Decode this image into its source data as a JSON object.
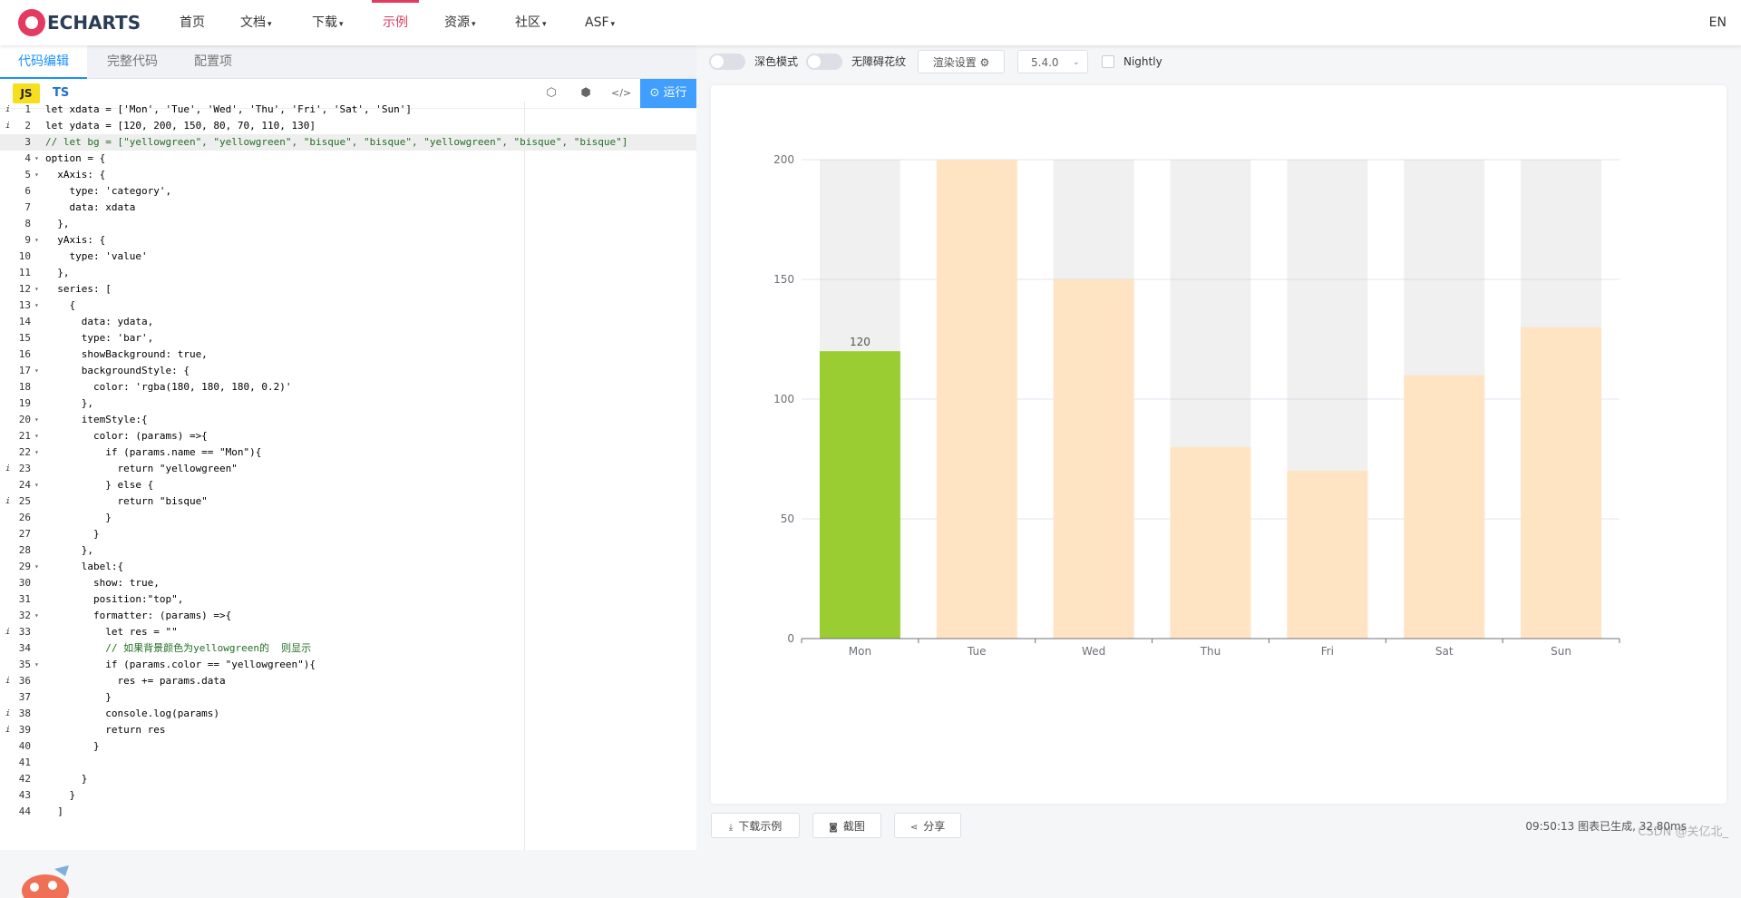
{
  "nav": {
    "logo": "ECHARTS",
    "items": [
      {
        "label": "首页",
        "caret": ""
      },
      {
        "label": "文档",
        "caret": "▾"
      },
      {
        "label": "下载",
        "caret": "▾"
      },
      {
        "label": "示例",
        "caret": ""
      },
      {
        "label": "资源",
        "caret": "▾"
      },
      {
        "label": "社区",
        "caret": "▾"
      },
      {
        "label": "ASF",
        "caret": "▾"
      }
    ],
    "active_item": "示例",
    "lang": "EN"
  },
  "editor": {
    "tabs": [
      "代码编辑",
      "完整代码",
      "配置项"
    ],
    "active_tab": "代码编辑",
    "lang_js": "JS",
    "lang_ts": "TS",
    "run_label": "运行",
    "run_icon": "⊙",
    "tool_icons": [
      "codepen-icon",
      "codesandbox-icon",
      "code-icon"
    ],
    "tool_glyphs": [
      "⬡",
      "⬢",
      "</>"
    ],
    "highlight_line": 3,
    "info_lines": [
      1,
      2,
      23,
      25,
      33,
      36,
      38,
      39
    ],
    "fold_lines": [
      4,
      5,
      9,
      12,
      13,
      17,
      20,
      21,
      22,
      24,
      29,
      32,
      35
    ],
    "lines": [
      "let xdata = ['Mon', 'Tue', 'Wed', 'Thu', 'Fri', 'Sat', 'Sun']",
      "let ydata = [120, 200, 150, 80, 70, 110, 130]",
      "// let bg = [\"yellowgreen\", \"yellowgreen\", \"bisque\", \"bisque\", \"yellowgreen\", \"bisque\", \"bisque\"]",
      "option = {",
      "  xAxis: {",
      "    type: 'category',",
      "    data: xdata",
      "  },",
      "  yAxis: {",
      "    type: 'value'",
      "  },",
      "  series: [",
      "    {",
      "      data: ydata,",
      "      type: 'bar',",
      "      showBackground: true,",
      "      backgroundStyle: {",
      "        color: 'rgba(180, 180, 180, 0.2)'",
      "      },",
      "      itemStyle:{",
      "        color: (params) =>{",
      "          if (params.name == \"Mon\"){",
      "            return \"yellowgreen\"",
      "          } else {",
      "            return \"bisque\"",
      "          }",
      "        }",
      "      },",
      "      label:{",
      "        show: true,",
      "        position:\"top\",",
      "        formatter: (params) =>{",
      "          let res = \"\"",
      "          // 如果背景颜色为yellowgreen的  则显示",
      "          if (params.color == \"yellowgreen\"){",
      "            res += params.data",
      "          }",
      "          console.log(params)",
      "          return res",
      "        }",
      "",
      "      }",
      "    }",
      "  ]"
    ]
  },
  "preview": {
    "dark_mode_label": "深色模式",
    "accessible_label": "无障碍花纹",
    "render_label": "渲染设置",
    "render_icon": "⚙",
    "version": "5.4.0",
    "version_caret": "⌄",
    "nightly_label": "Nightly",
    "download_label": "下载示例",
    "download_icon": "⤓",
    "screenshot_label": "截图",
    "screenshot_icon": "◙",
    "share_label": "分享",
    "share_icon": "⋖",
    "status": "09:50:13  图表已生成, 32.80ms",
    "watermark": "CSDN @关亿北_"
  },
  "colors": {
    "highlight": "#9acd32",
    "bar": "#ffe4c4",
    "background_bar": "rgba(180,180,180,0.2)",
    "accent": "#e43961",
    "run": "#409eff"
  },
  "chart_data": {
    "type": "bar",
    "categories": [
      "Mon",
      "Tue",
      "Wed",
      "Thu",
      "Fri",
      "Sat",
      "Sun"
    ],
    "values": [
      120,
      200,
      150,
      80,
      70,
      110,
      130
    ],
    "ylim": [
      0,
      200
    ],
    "yticks": [
      0,
      50,
      100,
      150,
      200
    ],
    "bar_colors": [
      "#9acd32",
      "#ffe4c4",
      "#ffe4c4",
      "#ffe4c4",
      "#ffe4c4",
      "#ffe4c4",
      "#ffe4c4"
    ],
    "data_labels": [
      "120",
      "",
      "",
      "",
      "",
      "",
      ""
    ],
    "show_background": true,
    "grid": true,
    "title": "",
    "xlabel": "",
    "ylabel": ""
  }
}
